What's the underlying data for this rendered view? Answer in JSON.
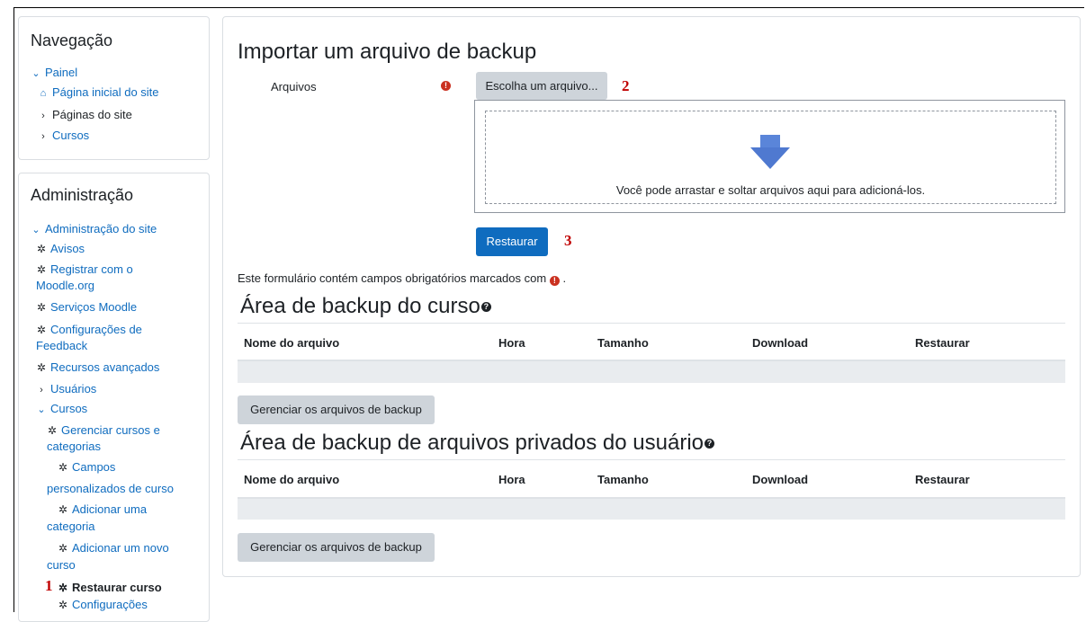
{
  "navigation": {
    "title": "Navegação",
    "items": [
      {
        "label": "Painel",
        "icon": "chevron-down-icon"
      },
      {
        "label": "Página inicial do site",
        "icon": "home-icon"
      },
      {
        "label": "Páginas do site",
        "icon": "chevron-right-icon"
      },
      {
        "label": "Cursos",
        "icon": "chevron-right-icon"
      }
    ]
  },
  "administration": {
    "title": "Administração",
    "items": {
      "site_admin": "Administração do site",
      "avisos": "Avisos",
      "registrar_line1": "Registrar com o",
      "registrar_line2": "Moodle.org",
      "servicos": "Serviços Moodle",
      "config_feedback_line1": "Configurações de",
      "config_feedback_line2": "Feedback",
      "recursos": "Recursos avançados",
      "usuarios": "Usuários",
      "cursos": "Cursos",
      "gerenciar_line1": "Gerenciar cursos e",
      "gerenciar_line2": "categorias",
      "campos_line1": "Campos",
      "campos_line2": "personalizados de curso",
      "adicionar_cat_line1": "Adicionar uma",
      "adicionar_cat_line2": "categoria",
      "adicionar_curso_line1": "Adicionar um novo",
      "adicionar_curso_line2": "curso",
      "restaurar_curso": "Restaurar curso",
      "configuracoes": "Configurações"
    }
  },
  "annotations": {
    "one": "1",
    "two": "2",
    "three": "3"
  },
  "import": {
    "title": "Importar um arquivo de backup",
    "files_label": "Arquivos",
    "choose_button": "Escolha um arquivo...",
    "drop_text": "Você pode arrastar e soltar arquivos aqui para adicioná-los.",
    "restore_button": "Restaurar",
    "required_note": "Este formulário contém campos obrigatórios marcados com",
    "required_note_end": "."
  },
  "course_area": {
    "title": "Área de backup do curso",
    "columns": [
      "Nome do arquivo",
      "Hora",
      "Tamanho",
      "Download",
      "Restaurar"
    ],
    "manage_button": "Gerenciar os arquivos de backup"
  },
  "user_area": {
    "title": "Área de backup de arquivos privados do usuário",
    "columns": [
      "Nome do arquivo",
      "Hora",
      "Tamanho",
      "Download",
      "Restaurar"
    ],
    "manage_button": "Gerenciar os arquivos de backup"
  },
  "colors": {
    "link": "#0f6cbf",
    "primary_button": "#0f6cbf",
    "required": "#ca3120",
    "annotation": "#c00000"
  }
}
